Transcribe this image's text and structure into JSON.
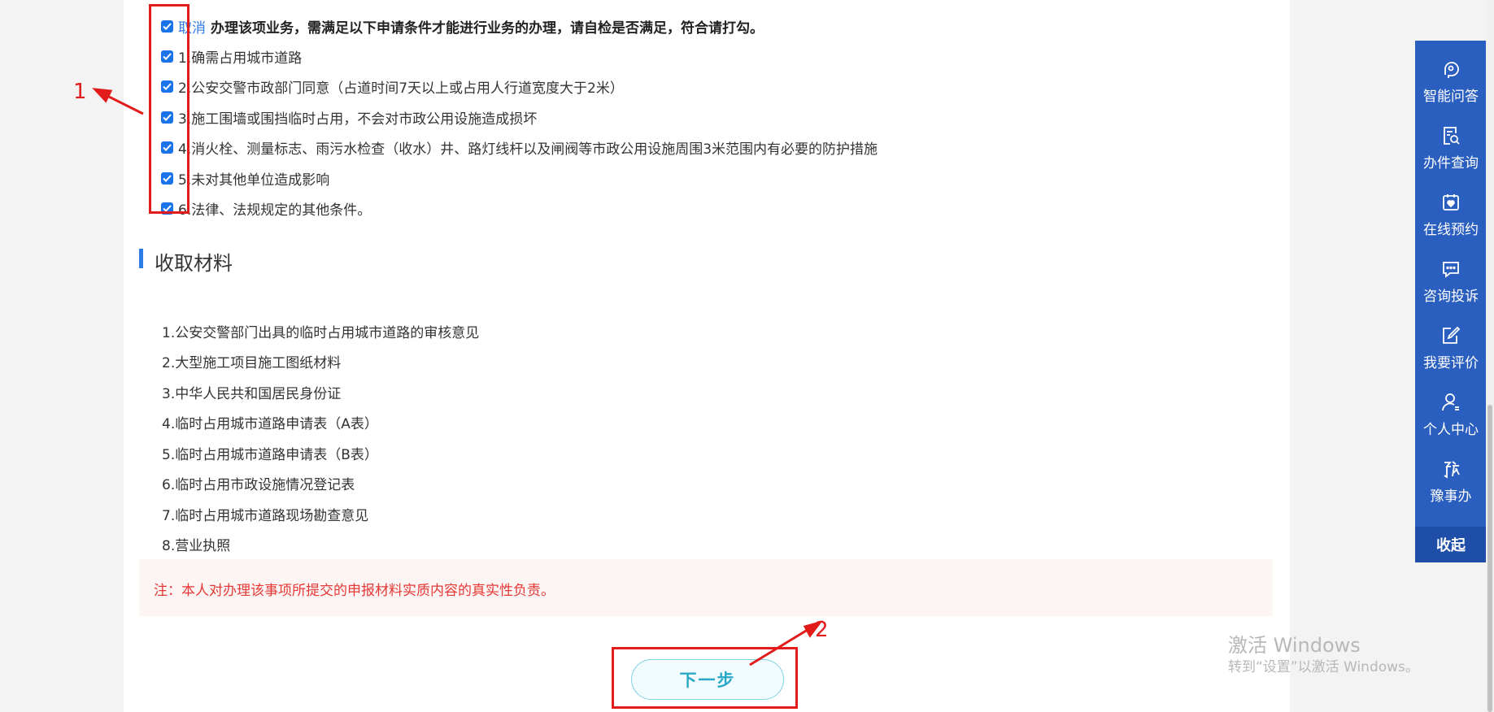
{
  "conditions": {
    "cancel_label": "取消",
    "header_text": "办理该项业务，需满足以下申请条件才能进行业务的办理，请自检是否满足，符合请打勾。",
    "items": [
      {
        "label": "1.确需占用城市道路",
        "checked": true
      },
      {
        "label": "2.公安交警市政部门同意（占道时间7天以上或占用人行道宽度大于2米）",
        "checked": true
      },
      {
        "label": "3.施工围墙或围挡临时占用，不会对市政公用设施造成损坏",
        "checked": true
      },
      {
        "label": "4.消火栓、测量标志、雨污水检查（收水）井、路灯线杆以及闸阀等市政公用设施周围3米范围内有必要的防护措施",
        "checked": true
      },
      {
        "label": "5.未对其他单位造成影响",
        "checked": true
      },
      {
        "label": "6.法律、法规规定的其他条件。",
        "checked": true
      }
    ]
  },
  "materials": {
    "title": "收取材料",
    "items": [
      "1.公安交警部门出具的临时占用城市道路的审核意见",
      "2.大型施工项目施工图纸材料",
      "3.中华人民共和国居民身份证",
      "4.临时占用城市道路申请表（A表）",
      "5.临时占用城市道路申请表（B表）",
      "6.临时占用市政设施情况登记表",
      "7.临时占用城市道路现场勘查意见",
      "8.营业执照"
    ]
  },
  "note": "注：本人对办理该事项所提交的申报材料实质内容的真实性负责。",
  "next_button": "下一步",
  "annotations": {
    "label_1": "1",
    "label_2": "2",
    "color": "#e21b1b"
  },
  "sidebar": {
    "items": [
      {
        "label": "智能问答",
        "icon": "robot-head-icon"
      },
      {
        "label": "办件查询",
        "icon": "document-search-icon"
      },
      {
        "label": "在线预约",
        "icon": "calendar-heart-icon"
      },
      {
        "label": "咨询投诉",
        "icon": "chat-bubble-icon"
      },
      {
        "label": "我要评价",
        "icon": "edit-pen-icon"
      },
      {
        "label": "个人中心",
        "icon": "user-icon"
      },
      {
        "label": "豫事办",
        "icon": "yushiban-logo-icon"
      }
    ],
    "collapse_label": "收起",
    "bg_color": "#2a5ebf"
  },
  "watermark": {
    "line1": "激活 Windows",
    "line2": "转到“设置”以激活 Windows。"
  }
}
